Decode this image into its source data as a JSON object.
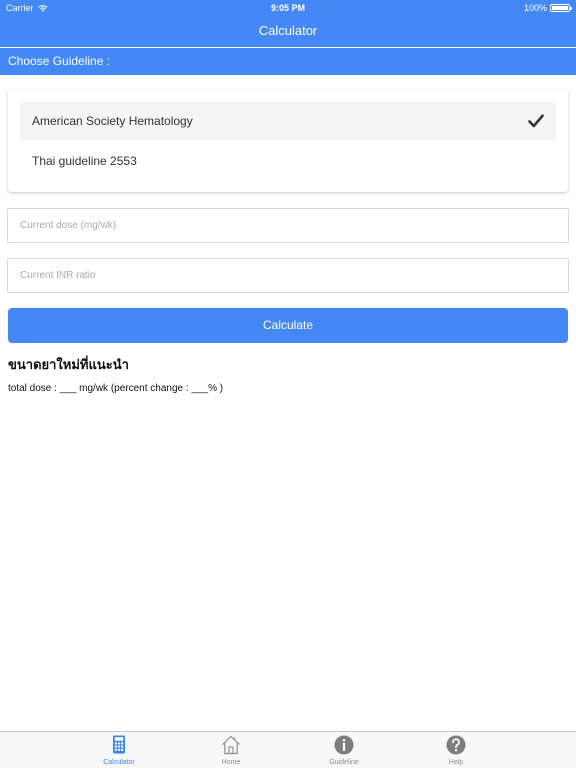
{
  "status_bar": {
    "carrier": "Carrier",
    "time": "9:05 PM",
    "battery": "100%"
  },
  "nav": {
    "title": "Calculator"
  },
  "section": {
    "title": "Choose Guideline :"
  },
  "guidelines": {
    "options": [
      {
        "label": "American Society Hematology",
        "selected": true
      },
      {
        "label": "Thai guideline 2553",
        "selected": false
      }
    ]
  },
  "form": {
    "dose_placeholder": "Current dose (mg/wk)",
    "dose_value": "",
    "inr_placeholder": "Current INR ratio",
    "inr_value": "",
    "calculate_label": "Calculate"
  },
  "result": {
    "heading": "ขนาดยาใหม่ที่แนะนำ",
    "text": "total dose : ___ mg/wk (percent change : ___% )"
  },
  "tabs": [
    {
      "label": "Calculator",
      "icon": "calculator-icon",
      "active": true
    },
    {
      "label": "Home",
      "icon": "home-icon",
      "active": false
    },
    {
      "label": "Guideline",
      "icon": "info-icon",
      "active": false
    },
    {
      "label": "Help",
      "icon": "help-icon",
      "active": false
    }
  ],
  "colors": {
    "accent": "#4388f4",
    "tab_active": "#3a86f0",
    "tab_inactive": "#8e8e8e"
  }
}
